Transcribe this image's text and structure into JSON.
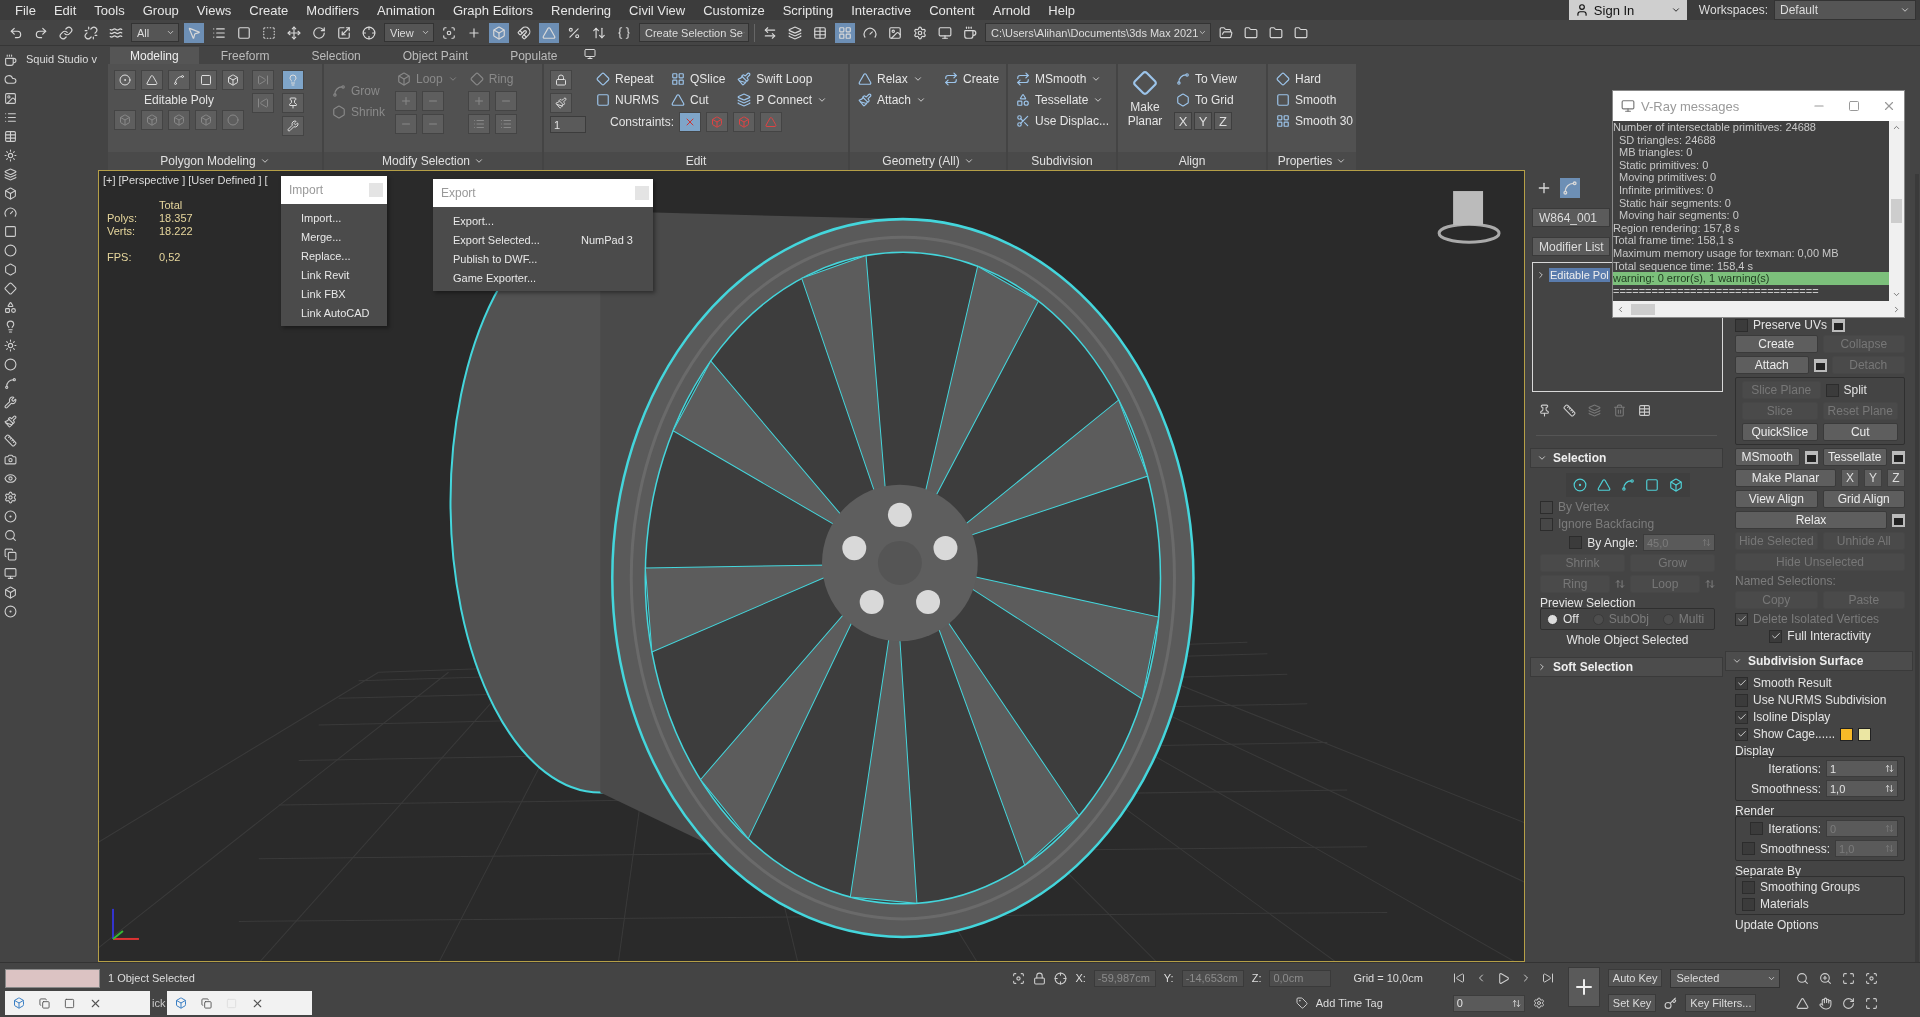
{
  "menu_bar": {
    "items": [
      "File",
      "Edit",
      "Tools",
      "Group",
      "Views",
      "Create",
      "Modifiers",
      "Animation",
      "Graph Editors",
      "Rendering",
      "Civil View",
      "Customize",
      "Scripting",
      "Interactive",
      "Content",
      "Arnold",
      "Help"
    ],
    "sign_in": "Sign In",
    "workspaces_label": "Workspaces:",
    "workspace": "Default"
  },
  "toolbar": {
    "selection_filter": "All",
    "reference_coord": "View",
    "named_selection": "Create Selection Se",
    "project_path": "C:\\Users\\Alihan\\Documents\\3ds Max 2021"
  },
  "side_label": "Squid Studio v",
  "ribbon": {
    "tabs": [
      {
        "label": "Modeling",
        "selected": true
      },
      {
        "label": "Freeform",
        "selected": false
      },
      {
        "label": "Selection",
        "selected": false
      },
      {
        "label": "Object Paint",
        "selected": false
      },
      {
        "label": "Populate",
        "selected": false
      }
    ],
    "groups": [
      {
        "kind": "polygon",
        "title": "Polygon Modeling",
        "title_menu": true,
        "object": "Editable Poly"
      },
      {
        "kind": "modify",
        "title": "Modify Selection",
        "title_menu": true,
        "items": [
          {
            "label": "Grow",
            "disabled": true,
            "dropdown": false
          },
          {
            "label": "Shrink",
            "disabled": true,
            "dropdown": false
          },
          {
            "label": "Loop",
            "disabled": true,
            "dropdown": true
          },
          {
            "label": "Ring",
            "disabled": true,
            "dropdown": false
          }
        ]
      },
      {
        "kind": "edit",
        "title": "Edit",
        "title_menu": false,
        "spinner": "1",
        "constraints": "Constraints:",
        "columns": [
          [
            {
              "label": "Repeat",
              "disabled": false,
              "dropdown": false
            },
            {
              "label": "NURMS",
              "disabled": false,
              "dropdown": false
            }
          ],
          [
            {
              "label": "QSlice",
              "disabled": false,
              "dropdown": false
            },
            {
              "label": "Cut",
              "disabled": false,
              "dropdown": false
            }
          ],
          [
            {
              "label": "Swift Loop",
              "disabled": false,
              "dropdown": false
            },
            {
              "label": "P Connect",
              "disabled": false,
              "dropdown": true
            }
          ]
        ]
      },
      {
        "kind": "tools",
        "title": "Geometry (All)",
        "title_menu": true,
        "columns": [
          [
            {
              "label": "Relax",
              "disabled": false,
              "dropdown": true
            },
            {
              "label": "Attach",
              "disabled": false,
              "dropdown": true
            }
          ],
          [
            {
              "label": "Create",
              "disabled": false,
              "dropdown": false
            }
          ]
        ]
      },
      {
        "kind": "tools",
        "title": "Subdivision",
        "title_menu": false,
        "columns": [
          [
            {
              "label": "MSmooth",
              "disabled": false,
              "dropdown": true
            },
            {
              "label": "Tessellate",
              "disabled": false,
              "dropdown": true
            },
            {
              "label": "Use Displac...",
              "disabled": false,
              "dropdown": false
            }
          ]
        ]
      },
      {
        "kind": "align",
        "title": "Align",
        "title_menu": false,
        "big": "Make Planar",
        "columns": [
          [
            {
              "label": "To View",
              "disabled": false,
              "dropdown": false
            },
            {
              "label": "To Grid",
              "disabled": false,
              "dropdown": false
            }
          ]
        ],
        "axes": [
          "X",
          "Y",
          "Z"
        ]
      },
      {
        "kind": "tools",
        "title": "Properties",
        "title_menu": true,
        "columns": [
          [
            {
              "label": "Hard",
              "disabled": false,
              "dropdown": false
            },
            {
              "label": "Smooth",
              "disabled": false,
              "dropdown": false
            },
            {
              "label": "Smooth 30",
              "disabled": false,
              "dropdown": false
            }
          ]
        ]
      }
    ]
  },
  "viewport": {
    "labels": [
      "[+]",
      "[Perspective ]",
      "[User Defined ]",
      "["
    ],
    "stats": {
      "heading": "Total",
      "rows": [
        {
          "label": "Polys:",
          "value": "18.357"
        },
        {
          "label": "Verts:",
          "value": "18.222"
        }
      ],
      "fps_label": "FPS:",
      "fps": "0,52"
    }
  },
  "import_menu": {
    "title": "Import",
    "items": [
      {
        "label": "Import..."
      },
      {
        "label": "Merge..."
      },
      {
        "label": "Replace..."
      },
      {
        "label": "Link Revit"
      },
      {
        "label": "Link FBX"
      },
      {
        "label": "Link AutoCAD"
      }
    ]
  },
  "export_menu": {
    "title": "Export",
    "items": [
      {
        "label": "Export..."
      },
      {
        "label": "Export Selected...",
        "shortcut": "NumPad 3"
      },
      {
        "label": "Publish to DWF..."
      },
      {
        "label": "Game Exporter..."
      }
    ]
  },
  "vray_window": {
    "title": "V-Ray messages",
    "lines": [
      {
        "text": "Number of intersectable primitives: 24688",
        "selected": false,
        "children": [
          {
            "text": "SD triangles: 24688",
            "selected": false
          },
          {
            "text": "MB triangles: 0",
            "selected": false
          },
          {
            "text": "Static primitives: 0",
            "selected": false
          },
          {
            "text": "Moving primitives: 0",
            "selected": false
          },
          {
            "text": "Infinite primitives: 0",
            "selected": false
          },
          {
            "text": "Static hair segments: 0",
            "selected": false
          },
          {
            "text": "Moving hair segments: 0",
            "selected": false
          }
        ]
      },
      {
        "text": "Region rendering: 157,8 s",
        "selected": false
      },
      {
        "text": "Total frame time: 158,1 s",
        "selected": false
      },
      {
        "text": "Maximum memory usage for texman: 0,00 MB",
        "selected": false
      },
      {
        "text": "Total sequence time: 158,4 s",
        "selected": false
      },
      {
        "text": "warning: 0 error(s), 1 warning(s)",
        "selected": true
      },
      {
        "text": "================================",
        "selected": false
      }
    ]
  },
  "command_panel": {
    "object_name": "W864_001",
    "modifier_list": "Modifier List",
    "stack": [
      {
        "label": "Editable Pol",
        "selected": true
      }
    ],
    "left_rollouts": [
      {
        "title": "Selection",
        "expanded": true,
        "rows": [
          {
            "kind": "subobjects"
          },
          {
            "kind": "check",
            "label": "By Vertex",
            "checked": false,
            "disabled": true
          },
          {
            "kind": "check",
            "label": "Ignore Backfacing",
            "checked": false,
            "disabled": true
          },
          {
            "kind": "check_spinner",
            "label": "By Angle:",
            "value": "45,0",
            "checked": false,
            "disabled": true
          },
          {
            "kind": "buttons",
            "buttons": [
              {
                "kind": "plain",
                "label": "Shrink",
                "disabled": true
              },
              {
                "kind": "plain",
                "label": "Grow",
                "disabled": true
              }
            ]
          },
          {
            "kind": "buttons",
            "buttons": [
              {
                "kind": "spin",
                "label": "Ring",
                "disabled": true
              },
              {
                "kind": "spin",
                "label": "Loop",
                "disabled": true
              }
            ]
          },
          {
            "kind": "group",
            "title": "Preview Selection",
            "rows": [
              {
                "kind": "radios",
                "options": [
                  {
                    "label": "Off",
                    "selected": true,
                    "disabled": false
                  },
                  {
                    "label": "SubObj",
                    "selected": false,
                    "disabled": true
                  },
                  {
                    "label": "Multi",
                    "selected": false,
                    "disabled": true
                  }
                ]
              }
            ]
          },
          {
            "kind": "label",
            "text": "Whole Object Selected",
            "disabled": false
          }
        ]
      },
      {
        "title": "Soft Selection",
        "expanded": false
      }
    ],
    "right_rollouts": [
      {
        "rows": [
          {
            "kind": "check",
            "label": "Preserve UVs",
            "checked": false,
            "disabled": false,
            "settings": true
          },
          {
            "kind": "buttons",
            "buttons": [
              {
                "kind": "plain",
                "label": "Create",
                "disabled": false
              },
              {
                "kind": "plain",
                "label": "Collapse",
                "disabled": true
              }
            ]
          },
          {
            "kind": "buttons",
            "buttons": [
              {
                "kind": "settings",
                "label": "Attach",
                "disabled": false
              },
              {
                "kind": "plain",
                "label": "Detach",
                "disabled": true
              }
            ]
          },
          {
            "kind": "group",
            "rows": [
              {
                "kind": "buttons",
                "buttons": [
                  {
                    "kind": "plain",
                    "label": "Slice Plane",
                    "disabled": true
                  },
                  {
                    "kind": "check",
                    "label": "Split",
                    "disabled": false,
                    "checked": false
                  }
                ]
              },
              {
                "kind": "buttons",
                "buttons": [
                  {
                    "kind": "plain",
                    "label": "Slice",
                    "disabled": true
                  },
                  {
                    "kind": "plain",
                    "label": "Reset Plane",
                    "disabled": true
                  }
                ]
              },
              {
                "kind": "buttons",
                "buttons": [
                  {
                    "kind": "plain",
                    "label": "QuickSlice",
                    "disabled": false
                  },
                  {
                    "kind": "plain",
                    "label": "Cut",
                    "disabled": false
                  }
                ]
              }
            ]
          },
          {
            "kind": "buttons",
            "buttons": [
              {
                "kind": "settings",
                "label": "MSmooth",
                "disabled": false
              },
              {
                "kind": "settings",
                "label": "Tessellate",
                "disabled": false
              }
            ]
          },
          {
            "kind": "buttons",
            "buttons": [
              {
                "kind": "plain",
                "label": "Make Planar",
                "disabled": false
              },
              {
                "kind": "axis",
                "label": "X",
                "disabled": false
              },
              {
                "kind": "axis",
                "label": "Y",
                "disabled": false
              },
              {
                "kind": "axis",
                "label": "Z",
                "disabled": false
              }
            ]
          },
          {
            "kind": "buttons",
            "buttons": [
              {
                "kind": "plain",
                "label": "View Align",
                "disabled": false
              },
              {
                "kind": "plain",
                "label": "Grid Align",
                "disabled": false
              }
            ]
          },
          {
            "kind": "buttons",
            "buttons": [
              {
                "kind": "settings",
                "label": "Relax",
                "disabled": false
              }
            ]
          },
          {
            "kind": "buttons",
            "buttons": [
              {
                "kind": "plain",
                "label": "Hide Selected",
                "disabled": true
              },
              {
                "kind": "plain",
                "label": "Unhide All",
                "disabled": true
              }
            ]
          },
          {
            "kind": "buttons",
            "buttons": [
              {
                "kind": "plain",
                "label": "Hide Unselected",
                "disabled": true
              }
            ]
          },
          {
            "kind": "label",
            "text": "Named Selections:",
            "disabled": true
          },
          {
            "kind": "buttons",
            "buttons": [
              {
                "kind": "plain",
                "label": "Copy",
                "disabled": true
              },
              {
                "kind": "plain",
                "label": "Paste",
                "disabled": true
              }
            ]
          },
          {
            "kind": "check",
            "label": "Delete Isolated Vertices",
            "checked": true,
            "disabled": true
          },
          {
            "kind": "check",
            "label": "Full Interactivity",
            "checked": true,
            "disabled": false
          }
        ]
      },
      {
        "title": "Subdivision Surface",
        "expanded": true,
        "rows": [
          {
            "kind": "check",
            "label": "Smooth Result",
            "checked": true,
            "disabled": false
          },
          {
            "kind": "check",
            "label": "Use NURMS Subdivision",
            "checked": false,
            "disabled": false
          },
          {
            "kind": "check",
            "label": "Isoline Display",
            "checked": true,
            "disabled": false
          },
          {
            "kind": "check",
            "label": "Show Cage......",
            "checked": true,
            "disabled": false,
            "swatches": [
              {
                "color": "#f7b928"
              },
              {
                "color": "#ebe6a3"
              }
            ]
          },
          {
            "kind": "group",
            "title": "Display",
            "rows": [
              {
                "kind": "spinner",
                "label": "Iterations:",
                "value": "1",
                "disabled": false
              },
              {
                "kind": "spinner",
                "label": "Smoothness:",
                "value": "1,0",
                "disabled": false
              }
            ]
          },
          {
            "kind": "group",
            "title": "Render",
            "rows": [
              {
                "kind": "check_spinner",
                "label": "Iterations:",
                "value": "0",
                "checked": false,
                "disabled": true
              },
              {
                "kind": "check_spinner",
                "label": "Smoothness:",
                "value": "1,0",
                "checked": false,
                "disabled": true
              }
            ]
          },
          {
            "kind": "group",
            "title": "Separate By",
            "rows": [
              {
                "kind": "check",
                "label": "Smoothing Groups",
                "checked": false,
                "disabled": false
              },
              {
                "kind": "check",
                "label": "Materials",
                "checked": false,
                "disabled": false
              }
            ]
          },
          {
            "kind": "group",
            "title": "Update Options"
          }
        ]
      }
    ]
  },
  "status_bar": {
    "selection_count": "1 Object Selected",
    "prompt": "ick",
    "coords": [
      {
        "label": "X:",
        "value": "-59,987cm"
      },
      {
        "label": "Y:",
        "value": "-14,653cm"
      },
      {
        "label": "Z:",
        "value": "0,0cm"
      }
    ],
    "grid": "Grid = 10,0cm",
    "time_tag": "Add Time Tag",
    "frame": "0",
    "auto_key": "Auto Key",
    "set_key": "Set Key",
    "key_mode": "Selected",
    "key_filters": "Key Filters..."
  }
}
